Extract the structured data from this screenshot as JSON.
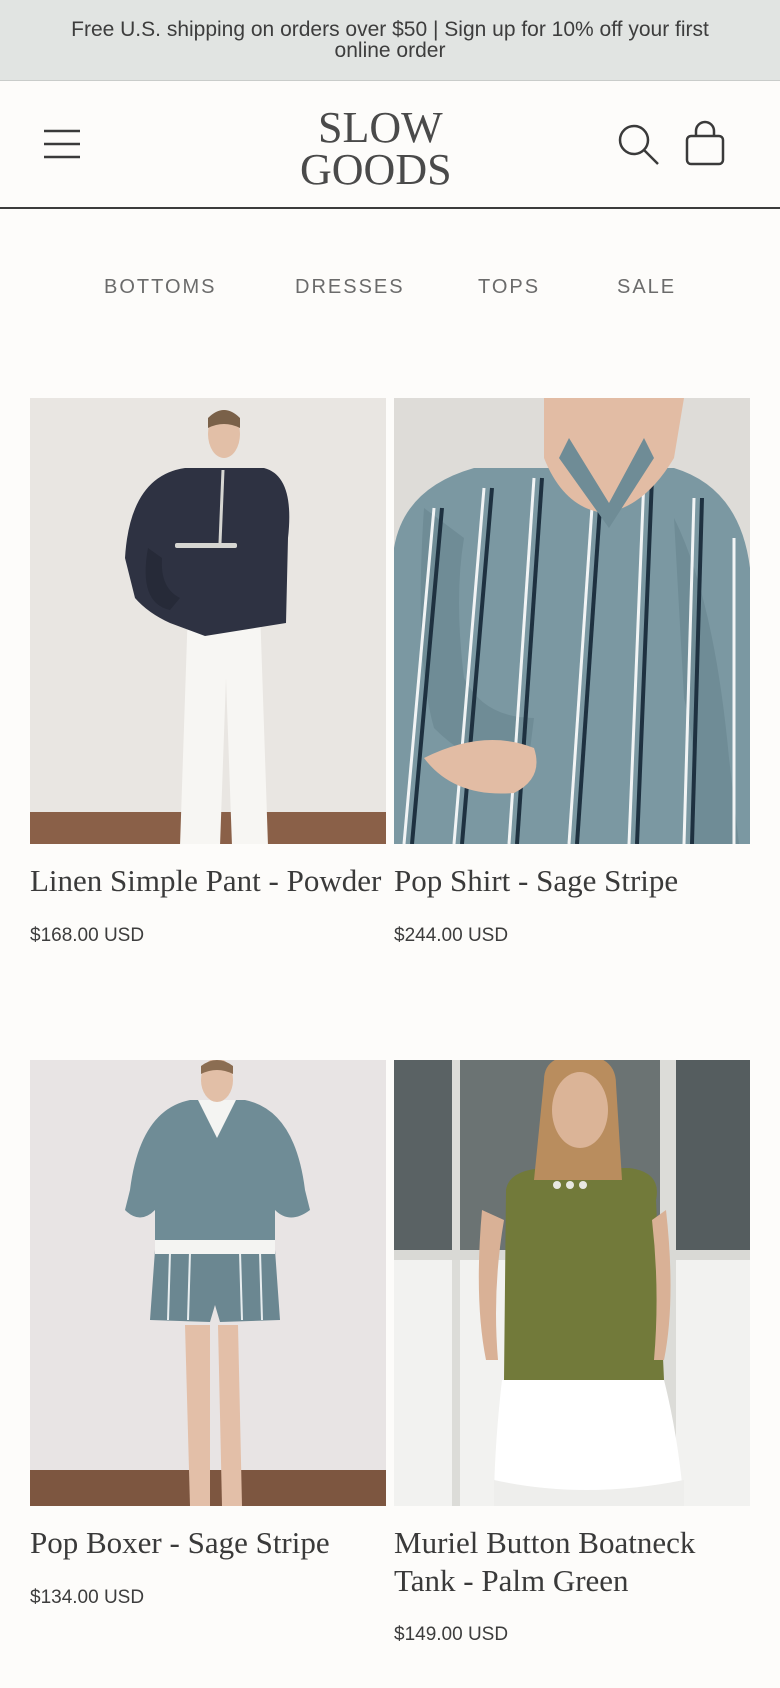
{
  "announcement": "Free U.S. shipping on orders over $50 | Sign up for 10% off your first online order",
  "header": {
    "logo_line1": "SLOW",
    "logo_line2": "GOODS",
    "icons": [
      "menu-icon",
      "search-icon",
      "cart-icon"
    ]
  },
  "categories": [
    "BOTTOMS",
    "DRESSES",
    "TOPS",
    "SALE"
  ],
  "products": [
    {
      "name": "Linen Simple Pant - Powder",
      "price": "$168.00 USD",
      "image": "person-in-navy-anorak-white-pants"
    },
    {
      "name": "Pop Shirt - Sage Stripe",
      "price": "$244.00 USD",
      "image": "person-in-sage-striped-shirt"
    },
    {
      "name": "Pop Boxer - Sage Stripe",
      "price": "$134.00 USD",
      "image": "person-in-sage-pullover-striped-shorts"
    },
    {
      "name": "Muriel Button Boatneck Tank - Palm Green",
      "price": "$149.00 USD",
      "image": "person-in-green-tank-white-skirt"
    }
  ],
  "colors": {
    "announcement_bg": "#e1e4e2",
    "page_bg": "#fdfcfa",
    "text": "#3a3a3a"
  }
}
